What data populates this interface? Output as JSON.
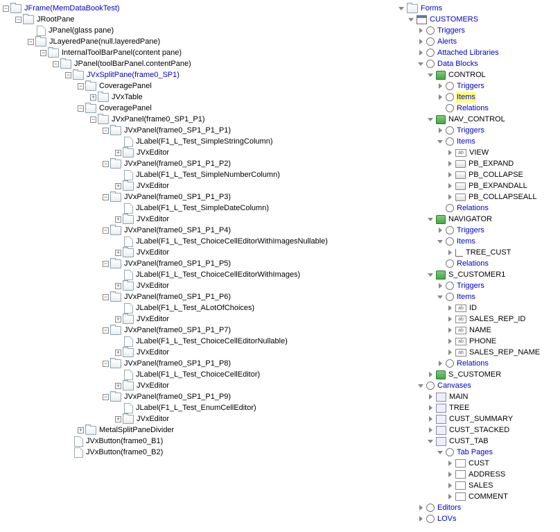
{
  "leftTree": [
    {
      "d": 0,
      "t": "m",
      "ic": "folder",
      "txt": "JFrame(MemDataBookTest)",
      "blue": true
    },
    {
      "d": 1,
      "t": "m",
      "ic": "folder",
      "txt": "JRootPane"
    },
    {
      "d": 2,
      "t": "b",
      "ic": "file",
      "txt": "JPanel(glass pane)"
    },
    {
      "d": 2,
      "t": "m",
      "ic": "folder",
      "txt": "JLayeredPane(null.layeredPane)"
    },
    {
      "d": 3,
      "t": "m",
      "ic": "folder",
      "txt": "InternalToolBarPanel(content pane)"
    },
    {
      "d": 4,
      "t": "m",
      "ic": "folder",
      "txt": "JPanel(toolBarPanel.contentPane)"
    },
    {
      "d": 5,
      "t": "m",
      "ic": "folder",
      "txt": "JVxSplitPane(frame0_SP1)",
      "blue": true
    },
    {
      "d": 6,
      "t": "m",
      "ic": "folder",
      "txt": "CoveragePanel"
    },
    {
      "d": 7,
      "t": "p",
      "ic": "folder",
      "txt": "JVxTable"
    },
    {
      "d": 6,
      "t": "m",
      "ic": "folder",
      "txt": "CoveragePanel"
    },
    {
      "d": 7,
      "t": "m",
      "ic": "folder",
      "txt": "JVxPanel(frame0_SP1_P1)"
    },
    {
      "d": 8,
      "t": "m",
      "ic": "folder",
      "txt": "JVxPanel(frame0_SP1_P1_P1)"
    },
    {
      "d": 9,
      "t": "b",
      "ic": "file",
      "txt": "JLabel(F1_L_Test_SimpleStringColumn)"
    },
    {
      "d": 9,
      "t": "p",
      "ic": "folder",
      "txt": "JVxEditor"
    },
    {
      "d": 8,
      "t": "m",
      "ic": "folder",
      "txt": "JVxPanel(frame0_SP1_P1_P2)"
    },
    {
      "d": 9,
      "t": "b",
      "ic": "file",
      "txt": "JLabel(F1_L_Test_SimpleNumberColumn)"
    },
    {
      "d": 9,
      "t": "p",
      "ic": "folder",
      "txt": "JVxEditor"
    },
    {
      "d": 8,
      "t": "m",
      "ic": "folder",
      "txt": "JVxPanel(frame0_SP1_P1_P3)"
    },
    {
      "d": 9,
      "t": "b",
      "ic": "file",
      "txt": "JLabel(F1_L_Test_SimpleDateColumn)"
    },
    {
      "d": 9,
      "t": "p",
      "ic": "folder",
      "txt": "JVxEditor"
    },
    {
      "d": 8,
      "t": "m",
      "ic": "folder",
      "txt": "JVxPanel(frame0_SP1_P1_P4)"
    },
    {
      "d": 9,
      "t": "b",
      "ic": "file",
      "txt": "JLabel(F1_L_Test_ChoiceCellEditorWithImagesNullable)"
    },
    {
      "d": 9,
      "t": "p",
      "ic": "folder",
      "txt": "JVxEditor"
    },
    {
      "d": 8,
      "t": "m",
      "ic": "folder",
      "txt": "JVxPanel(frame0_SP1_P1_P5)"
    },
    {
      "d": 9,
      "t": "b",
      "ic": "file",
      "txt": "JLabel(F1_L_Test_ChoiceCellEditorWithImages)"
    },
    {
      "d": 9,
      "t": "p",
      "ic": "folder",
      "txt": "JVxEditor"
    },
    {
      "d": 8,
      "t": "m",
      "ic": "folder",
      "txt": "JVxPanel(frame0_SP1_P1_P6)"
    },
    {
      "d": 9,
      "t": "b",
      "ic": "file",
      "txt": "JLabel(F1_L_Test_ALotOfChoices)"
    },
    {
      "d": 9,
      "t": "p",
      "ic": "folder",
      "txt": "JVxEditor"
    },
    {
      "d": 8,
      "t": "m",
      "ic": "folder",
      "txt": "JVxPanel(frame0_SP1_P1_P7)"
    },
    {
      "d": 9,
      "t": "b",
      "ic": "file",
      "txt": "JLabel(F1_L_Test_ChoiceCellEditorNullable)"
    },
    {
      "d": 9,
      "t": "p",
      "ic": "folder",
      "txt": "JVxEditor"
    },
    {
      "d": 8,
      "t": "m",
      "ic": "folder",
      "txt": "JVxPanel(frame0_SP1_P1_P8)"
    },
    {
      "d": 9,
      "t": "b",
      "ic": "file",
      "txt": "JLabel(F1_L_Test_ChoiceCellEditor)"
    },
    {
      "d": 9,
      "t": "p",
      "ic": "folder",
      "txt": "JVxEditor"
    },
    {
      "d": 8,
      "t": "m",
      "ic": "folder",
      "txt": "JVxPanel(frame0_SP1_P1_P9)"
    },
    {
      "d": 9,
      "t": "b",
      "ic": "file",
      "txt": "JLabel(F1_L_Test_EnumCellEditor)"
    },
    {
      "d": 9,
      "t": "p",
      "ic": "folder",
      "txt": "JVxEditor"
    },
    {
      "d": 6,
      "t": "p",
      "ic": "folder",
      "txt": "MetalSplitPaneDivider"
    },
    {
      "d": 5,
      "t": "b",
      "ic": "file",
      "txt": "JVxButton(frame0_B1)"
    },
    {
      "d": 5,
      "t": "b",
      "ic": "file",
      "txt": "JVxButton(frame0_B2)"
    }
  ],
  "rightTree": [
    {
      "d": 0,
      "h": "e",
      "ic": "folder",
      "txt": "Forms",
      "blue": true
    },
    {
      "d": 1,
      "h": "e",
      "ic": "form",
      "txt": "CUSTOMERS",
      "blue": true
    },
    {
      "d": 2,
      "h": "c",
      "ic": "circle",
      "txt": "Triggers",
      "blue": true
    },
    {
      "d": 2,
      "h": "c",
      "ic": "circle",
      "txt": "Alerts",
      "blue": true
    },
    {
      "d": 2,
      "h": "c",
      "ic": "circle",
      "txt": "Attached Libraries",
      "blue": true
    },
    {
      "d": 2,
      "h": "e",
      "ic": "circle",
      "txt": "Data Blocks",
      "blue": true
    },
    {
      "d": 3,
      "h": "e",
      "ic": "db",
      "txt": "CONTROL"
    },
    {
      "d": 4,
      "h": "c",
      "ic": "circle",
      "txt": "Triggers",
      "blue": true
    },
    {
      "d": 4,
      "h": "c",
      "ic": "circle",
      "txt": "Items",
      "blue": true,
      "hl": true
    },
    {
      "d": 4,
      "h": "n",
      "ic": "circle",
      "txt": "Relations",
      "blue": true
    },
    {
      "d": 3,
      "h": "e",
      "ic": "db",
      "txt": "NAV_CONTROL"
    },
    {
      "d": 4,
      "h": "c",
      "ic": "circle",
      "txt": "Triggers",
      "blue": true
    },
    {
      "d": 4,
      "h": "e",
      "ic": "circle",
      "txt": "Items",
      "blue": true
    },
    {
      "d": 5,
      "h": "c",
      "ic": "field",
      "txt": "VIEW"
    },
    {
      "d": 5,
      "h": "c",
      "ic": "btn",
      "txt": "PB_EXPAND"
    },
    {
      "d": 5,
      "h": "c",
      "ic": "btn",
      "txt": "PB_COLLAPSE"
    },
    {
      "d": 5,
      "h": "c",
      "ic": "btn",
      "txt": "PB_EXPANDALL"
    },
    {
      "d": 5,
      "h": "c",
      "ic": "btn",
      "txt": "PB_COLLAPSEALL"
    },
    {
      "d": 4,
      "h": "n",
      "ic": "circle",
      "txt": "Relations",
      "blue": true
    },
    {
      "d": 3,
      "h": "e",
      "ic": "db",
      "txt": "NAVIGATOR"
    },
    {
      "d": 4,
      "h": "c",
      "ic": "circle",
      "txt": "Triggers",
      "blue": true
    },
    {
      "d": 4,
      "h": "e",
      "ic": "circle",
      "txt": "Items",
      "blue": true
    },
    {
      "d": 5,
      "h": "c",
      "ic": "tree",
      "txt": "TREE_CUST"
    },
    {
      "d": 4,
      "h": "n",
      "ic": "circle",
      "txt": "Relations",
      "blue": true
    },
    {
      "d": 3,
      "h": "e",
      "ic": "db",
      "txt": "S_CUSTOMER1"
    },
    {
      "d": 4,
      "h": "c",
      "ic": "circle",
      "txt": "Triggers",
      "blue": true
    },
    {
      "d": 4,
      "h": "e",
      "ic": "circle",
      "txt": "Items",
      "blue": true
    },
    {
      "d": 5,
      "h": "c",
      "ic": "field",
      "txt": "ID"
    },
    {
      "d": 5,
      "h": "c",
      "ic": "field",
      "txt": "SALES_REP_ID"
    },
    {
      "d": 5,
      "h": "c",
      "ic": "field",
      "txt": "NAME"
    },
    {
      "d": 5,
      "h": "c",
      "ic": "field",
      "txt": "PHONE"
    },
    {
      "d": 5,
      "h": "c",
      "ic": "field",
      "txt": "SALES_REP_NAME"
    },
    {
      "d": 4,
      "h": "c",
      "ic": "circle",
      "txt": "Relations",
      "blue": true
    },
    {
      "d": 3,
      "h": "c",
      "ic": "db",
      "txt": "S_CUSTOMER"
    },
    {
      "d": 2,
      "h": "e",
      "ic": "circle",
      "txt": "Canvases",
      "blue": true
    },
    {
      "d": 3,
      "h": "c",
      "ic": "canvas",
      "txt": "MAIN"
    },
    {
      "d": 3,
      "h": "c",
      "ic": "canvas",
      "txt": "TREE"
    },
    {
      "d": 3,
      "h": "c",
      "ic": "canvas",
      "txt": "CUST_SUMMARY"
    },
    {
      "d": 3,
      "h": "c",
      "ic": "canvas",
      "txt": "CUST_STACKED"
    },
    {
      "d": 3,
      "h": "e",
      "ic": "canvas",
      "txt": "CUST_TAB"
    },
    {
      "d": 4,
      "h": "e",
      "ic": "circle",
      "txt": "Tab Pages",
      "blue": true
    },
    {
      "d": 5,
      "h": "c",
      "ic": "tab",
      "txt": "CUST"
    },
    {
      "d": 5,
      "h": "c",
      "ic": "tab",
      "txt": "ADDRESS"
    },
    {
      "d": 5,
      "h": "c",
      "ic": "tab",
      "txt": "SALES"
    },
    {
      "d": 5,
      "h": "c",
      "ic": "tab",
      "txt": "COMMENT"
    },
    {
      "d": 2,
      "h": "c",
      "ic": "circle",
      "txt": "Editors",
      "blue": true
    },
    {
      "d": 2,
      "h": "c",
      "ic": "circle",
      "txt": "LOVs",
      "blue": true
    }
  ]
}
